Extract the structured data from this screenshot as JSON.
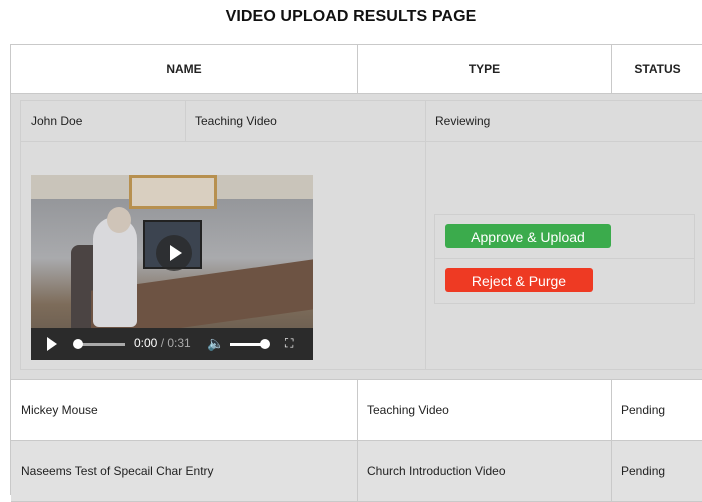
{
  "page": {
    "title": "VIDEO UPLOAD RESULTS PAGE"
  },
  "table": {
    "headers": {
      "name": "NAME",
      "type": "TYPE",
      "status": "STATUS"
    },
    "expanded": {
      "name": "John Doe",
      "type": "Teaching Video",
      "status": "Reviewing",
      "video": {
        "current_time": "0:00",
        "duration": "/ 0:31"
      },
      "actions": {
        "approve_label": "Approve & Upload",
        "reject_label": "Reject & Purge"
      }
    },
    "rows": [
      {
        "name": "Mickey Mouse",
        "type": "Teaching Video",
        "status": "Pending"
      },
      {
        "name": "Naseems Test of Specail Char Entry",
        "type": "Church Introduction Video",
        "status": "Pending"
      }
    ]
  },
  "colors": {
    "approve": "#3bab4c",
    "reject": "#ee3a23",
    "expanded_bg": "#dcdcdc",
    "alt_row_bg": "#e1e1e1"
  },
  "icons": [
    "play-icon",
    "volume-icon",
    "fullscreen-icon",
    "big-play-icon"
  ]
}
